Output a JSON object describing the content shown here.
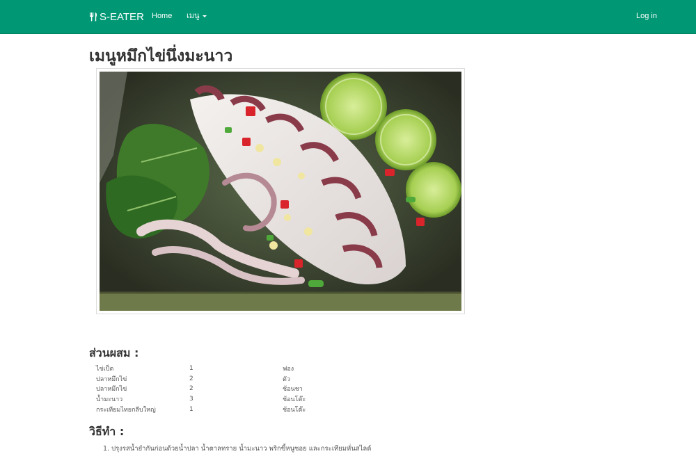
{
  "navbar": {
    "brand": "S-EATER",
    "brand_icon": "utensils-icon",
    "home": "Home",
    "menu": "เมนู",
    "login": "Log in",
    "bg_color": "#009874"
  },
  "page": {
    "title": "เมนูหมึกไข่นึ่งมะนาว"
  },
  "image": {
    "alt": "หมึกไข่นึ่งมะนาว"
  },
  "ingredients": {
    "heading": "ส่วนผสม :",
    "rows": [
      {
        "name": "ไข่เป็ด",
        "qty": "1",
        "unit": "ฟอง"
      },
      {
        "name": "ปลาหมึกไข่",
        "qty": "2",
        "unit": "ตัว"
      },
      {
        "name": "ปลาหมึกไข่",
        "qty": "2",
        "unit": "ช้อนชา"
      },
      {
        "name": "น้ำมะนาว",
        "qty": "3",
        "unit": "ช้อนโต๊ะ"
      },
      {
        "name": "กระเทียมไทยกลีบใหญ่",
        "qty": "1",
        "unit": "ช้อนโต๊ะ"
      }
    ]
  },
  "method": {
    "heading": "วิธีทำ :",
    "steps": [
      "1. ปรุงรสน้ำยำกันก่อนด้วยน้ำปลา น้ำตาลทราย น้ำมะนาว พริกขี้หนูซอย และกระเทียมหั่นสไลด์"
    ]
  }
}
